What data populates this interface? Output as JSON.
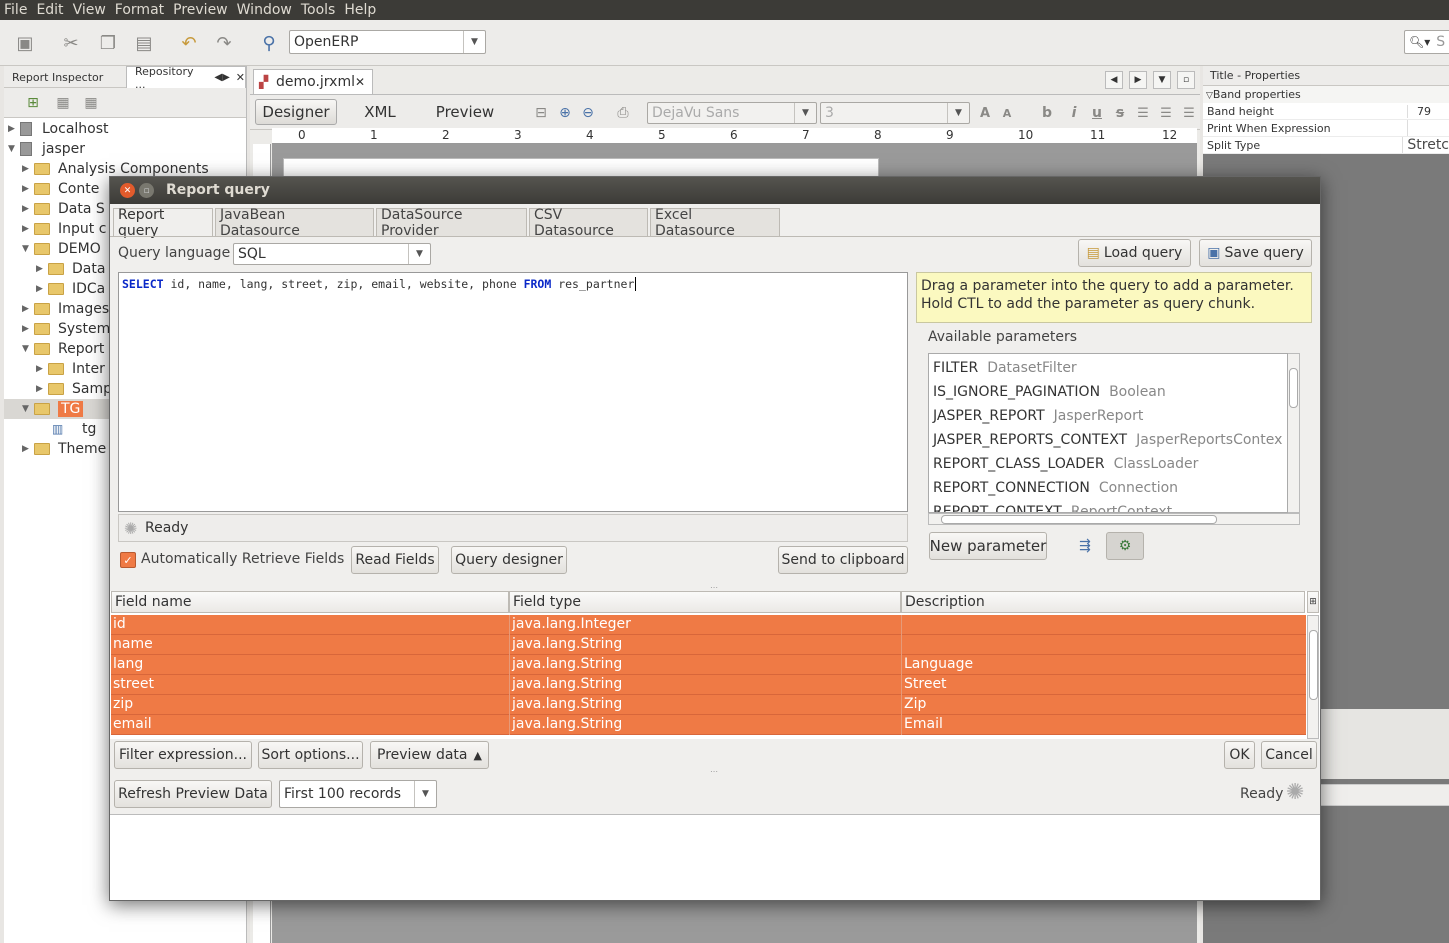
{
  "menubar": [
    "File",
    "Edit",
    "View",
    "Format",
    "Preview",
    "Window",
    "Tools",
    "Help"
  ],
  "toolbar": {
    "connection": "OpenERP",
    "search_placeholder": "S"
  },
  "left_panel": {
    "tabs": [
      "Report Inspector",
      "Repository ..."
    ],
    "tree": [
      {
        "label": "Localhost",
        "kind": "server"
      },
      {
        "label": "jasper",
        "kind": "server"
      },
      {
        "label": "Analysis Components",
        "kind": "folder"
      },
      {
        "label": "Conte",
        "kind": "folder"
      },
      {
        "label": "Data S",
        "kind": "folder"
      },
      {
        "label": "Input c",
        "kind": "folder"
      },
      {
        "label": "DEMO",
        "kind": "folder"
      },
      {
        "label": "Data",
        "kind": "folder"
      },
      {
        "label": "IDCa",
        "kind": "folder"
      },
      {
        "label": "Images",
        "kind": "folder"
      },
      {
        "label": "System",
        "kind": "folder"
      },
      {
        "label": "Report",
        "kind": "folder"
      },
      {
        "label": "Inter",
        "kind": "folder"
      },
      {
        "label": "Samp",
        "kind": "folder"
      },
      {
        "label": "TG",
        "kind": "folder"
      },
      {
        "label": "tg",
        "kind": "report"
      },
      {
        "label": "Theme",
        "kind": "folder"
      }
    ]
  },
  "editor": {
    "doc_tab": "demo.jrxml",
    "view_tabs": [
      "Designer",
      "XML",
      "Preview"
    ],
    "font": "DejaVu Sans",
    "font_size": "3",
    "ruler": [
      "0",
      "1",
      "2",
      "3",
      "4",
      "5",
      "6",
      "7",
      "8",
      "9",
      "10",
      "11",
      "12"
    ]
  },
  "properties": {
    "title": "Title - Properties",
    "section": "Band properties",
    "rows": [
      {
        "name": "Band height",
        "value": "79"
      },
      {
        "name": "Print When Expression",
        "value": ""
      },
      {
        "name": "Split Type",
        "value": "Stretc"
      }
    ]
  },
  "dialog": {
    "title": "Report query",
    "tabs": [
      "Report query",
      "JavaBean Datasource",
      "DataSource Provider",
      "CSV Datasource",
      "Excel Datasource"
    ],
    "query_language_label": "Query language",
    "query_language": "SQL",
    "load_query": "Load query",
    "save_query": "Save query",
    "query": {
      "kw_select": "SELECT",
      "columns": " id, name, lang, street, zip, email, website, phone ",
      "kw_from": "FROM",
      "table": " res_partner"
    },
    "hint": "Drag a parameter into the query to add a parameter. Hold CTL to add the parameter as query chunk.",
    "available_parameters_label": "Available parameters",
    "parameters": [
      {
        "name": "FILTER",
        "type": "DatasetFilter"
      },
      {
        "name": "IS_IGNORE_PAGINATION",
        "type": "Boolean"
      },
      {
        "name": "JASPER_REPORT",
        "type": "JasperReport"
      },
      {
        "name": "JASPER_REPORTS_CONTEXT",
        "type": "JasperReportsContex"
      },
      {
        "name": "REPORT_CLASS_LOADER",
        "type": "ClassLoader"
      },
      {
        "name": "REPORT_CONNECTION",
        "type": "Connection"
      },
      {
        "name": "REPORT_CONTEXT",
        "type": "ReportContext"
      }
    ],
    "status": "Ready",
    "auto_retrieve": "Automatically Retrieve Fields",
    "auto_retrieve_checked": true,
    "read_fields": "Read Fields",
    "query_designer": "Query designer",
    "send_clipboard": "Send to clipboard",
    "new_parameter": "New parameter",
    "columns": [
      "Field name",
      "Field type",
      "Description"
    ],
    "fields": [
      {
        "name": "id",
        "type": "java.lang.Integer",
        "desc": ""
      },
      {
        "name": "name",
        "type": "java.lang.String",
        "desc": ""
      },
      {
        "name": "lang",
        "type": "java.lang.String",
        "desc": "Language"
      },
      {
        "name": "street",
        "type": "java.lang.String",
        "desc": "Street"
      },
      {
        "name": "zip",
        "type": "java.lang.String",
        "desc": "Zip"
      },
      {
        "name": "email",
        "type": "java.lang.String",
        "desc": "Email"
      }
    ],
    "filter_expression": "Filter expression...",
    "sort_options": "Sort options...",
    "preview_data": "Preview data",
    "ok": "OK",
    "cancel": "Cancel",
    "refresh_preview": "Refresh Preview Data",
    "records_option": "First 100 records",
    "preview_status": "Ready"
  },
  "colors": {
    "accent_row": "#ef7a45",
    "titlebar": "#3c3b37",
    "hint_bg": "#fbf9c0"
  }
}
